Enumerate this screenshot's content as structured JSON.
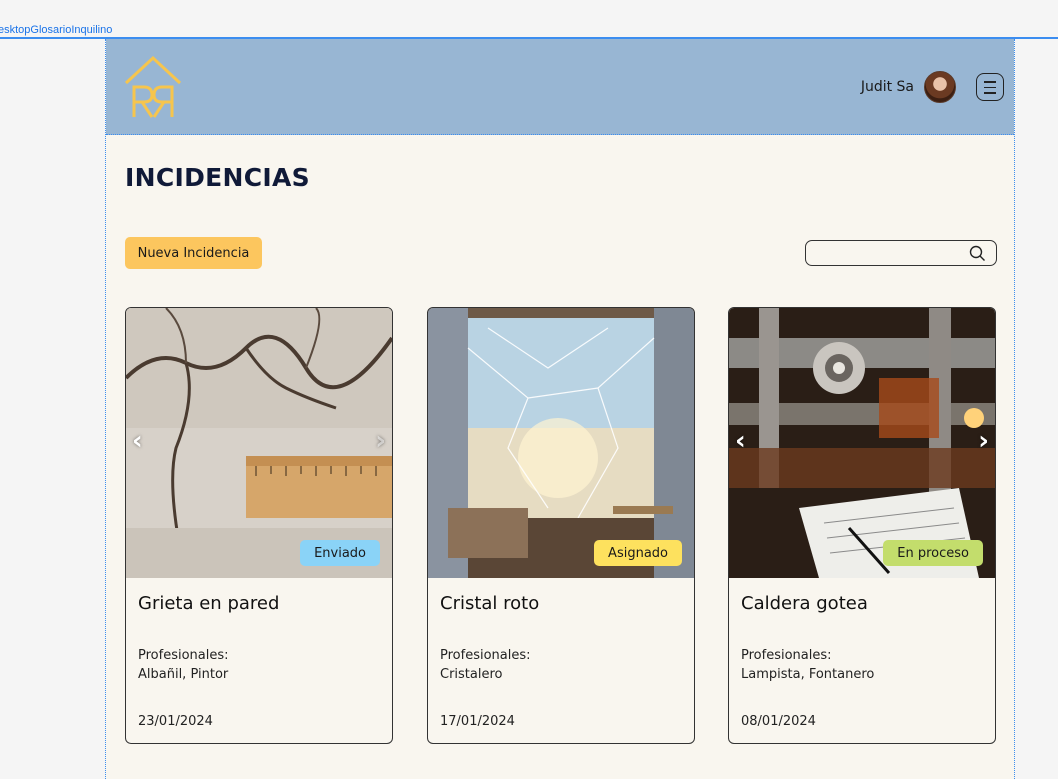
{
  "frame_label": "esktopGlosarioInquilino",
  "header": {
    "user_name": "Judit Sa"
  },
  "page_title": "INCIDENCIAS",
  "new_button_label": "Nueva Incidencia",
  "search": {
    "value": "",
    "placeholder": ""
  },
  "cards": [
    {
      "title": "Grieta en pared",
      "status": "Enviado",
      "status_color": "#8ad3f7",
      "professionals_label": "Profesionales:",
      "professionals": "Albañil, Pintor",
      "date": "23/01/2024"
    },
    {
      "title": "Cristal roto",
      "status": "Asignado",
      "status_color": "#fde15e",
      "professionals_label": "Profesionales:",
      "professionals": "Cristalero",
      "date": "17/01/2024"
    },
    {
      "title": "Caldera gotea",
      "status": "En proceso",
      "status_color": "#c3dd6c",
      "professionals_label": "Profesionales:",
      "professionals": "Lampista, Fontanero",
      "date": "08/01/2024"
    }
  ],
  "icons": {
    "logo": "house-logo-icon",
    "menu": "hamburger-menu-icon",
    "search": "search-icon",
    "prev": "chevron-left-icon",
    "next": "chevron-right-icon"
  }
}
